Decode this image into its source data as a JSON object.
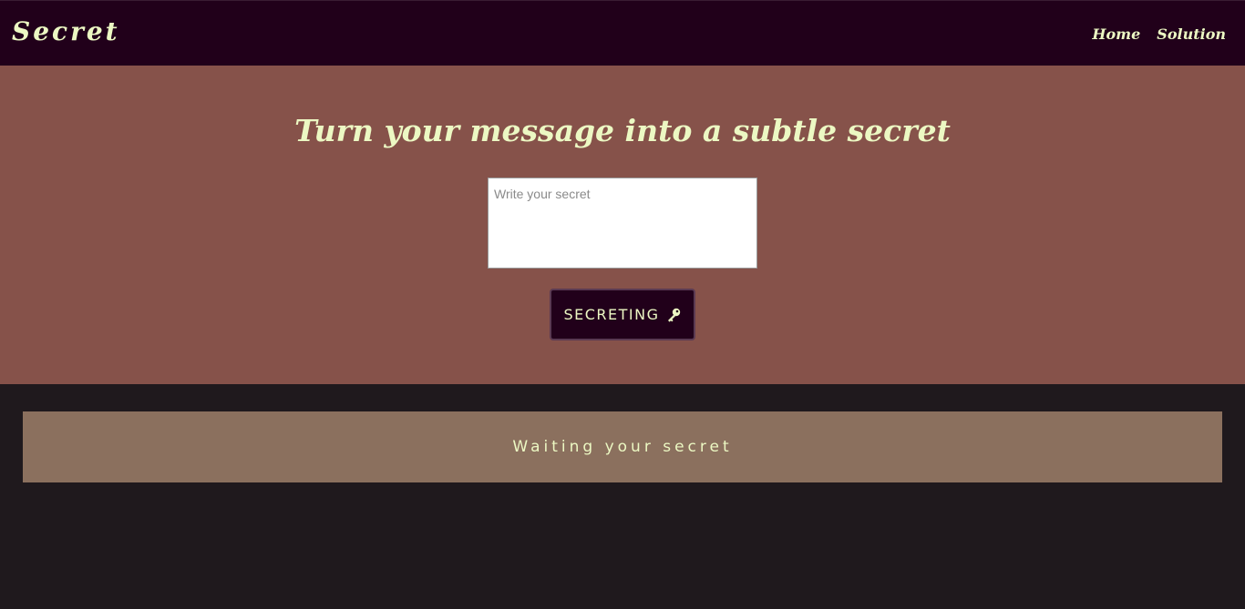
{
  "navbar": {
    "brand": "Secret",
    "links": [
      {
        "label": "Home"
      },
      {
        "label": "Solution"
      }
    ]
  },
  "hero": {
    "title": "Turn your message into a subtle secret",
    "input": {
      "placeholder": "Write your secret",
      "value": ""
    },
    "button": {
      "label": "SECRETING",
      "icon": "key-icon"
    }
  },
  "result": {
    "text": "Waiting your secret"
  },
  "colors": {
    "navbar_bg": "#21001a",
    "hero_bg": "#86524a",
    "page_bg": "#1f191d",
    "result_bg": "#8b705e",
    "accent_text": "#ecf8c3"
  }
}
